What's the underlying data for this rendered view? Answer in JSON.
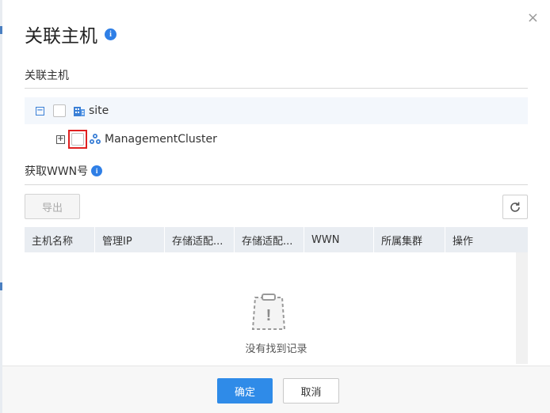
{
  "dialog": {
    "title": "关联主机",
    "close_glyph": "×"
  },
  "section1": {
    "label": "关联主机"
  },
  "tree": {
    "root": {
      "label": "site",
      "expander": "−",
      "icon": "site-building-icon"
    },
    "child": {
      "label": "ManagementCluster",
      "expander": "+",
      "icon": "cluster-icon"
    }
  },
  "section2": {
    "label": "获取WWN号"
  },
  "toolbar": {
    "export_label": "导出",
    "refresh_icon": "refresh-icon"
  },
  "table": {
    "columns": [
      "主机名称",
      "管理IP",
      "存储适配...",
      "存储适配...",
      "WWN",
      "所属集群",
      "操作"
    ],
    "empty_text": "没有找到记录",
    "empty_icon_glyph": "!"
  },
  "footer": {
    "ok_label": "确定",
    "cancel_label": "取消"
  },
  "colors": {
    "accent": "#2f8be8",
    "highlight": "#e02020",
    "header_bg": "#e9edf2"
  }
}
